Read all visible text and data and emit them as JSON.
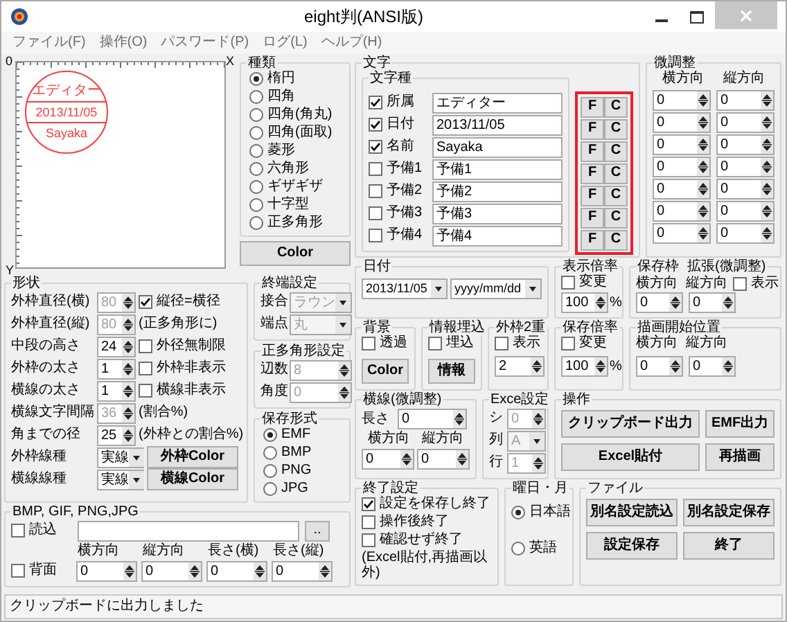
{
  "window": {
    "title": "eight判(ANSI版)"
  },
  "menu": [
    "ファイル(F)",
    "操作(O)",
    "パスワード(P)",
    "ログ(L)",
    "ヘルプ(H)"
  ],
  "preview": {
    "origin": "0",
    "x_axis": "X",
    "y_axis": "Y",
    "stamp": [
      "エディター",
      "2013/11/05",
      "Sayaka"
    ]
  },
  "shape_type": {
    "title": "種類",
    "options": [
      {
        "label": "楕円",
        "selected": true
      },
      {
        "label": "四角",
        "selected": false
      },
      {
        "label": "四角(角丸)",
        "selected": false
      },
      {
        "label": "四角(面取)",
        "selected": false
      },
      {
        "label": "菱形",
        "selected": false
      },
      {
        "label": "六角形",
        "selected": false
      },
      {
        "label": "ギザギザ",
        "selected": false
      },
      {
        "label": "十字型",
        "selected": false
      },
      {
        "label": "正多角形",
        "selected": false
      }
    ]
  },
  "color_button": "Color",
  "shape": {
    "title": "形状",
    "rows": [
      {
        "label": "外枠直径(横)",
        "kind": "spin",
        "value": "80",
        "disabled": true,
        "check": {
          "label": "縦径=横径",
          "checked": true
        }
      },
      {
        "label": "外枠直径(縦)",
        "kind": "spin",
        "value": "80",
        "disabled": true,
        "note": "(正多角形に)"
      },
      {
        "label": "中段の高さ",
        "kind": "spin",
        "value": "24",
        "disabled": false,
        "check": {
          "label": "外径無制限",
          "checked": false
        }
      },
      {
        "label": "外枠の太さ",
        "kind": "spin",
        "value": "1",
        "disabled": false,
        "check": {
          "label": "外枠非表示",
          "checked": false
        }
      },
      {
        "label": "横線の太さ",
        "kind": "spin",
        "value": "1",
        "disabled": false,
        "check": {
          "label": "横線非表示",
          "checked": false
        }
      },
      {
        "label": "横線文字間隔",
        "kind": "spin",
        "value": "36",
        "disabled": true,
        "note": "(割合%)"
      },
      {
        "label": "角までの径",
        "kind": "spin",
        "value": "25",
        "disabled": false,
        "note": "(外枠との割合%)"
      },
      {
        "label": "外枠線種",
        "kind": "select",
        "value": "実線",
        "disabled": false,
        "button": "外枠Color"
      },
      {
        "label": "横線線種",
        "kind": "select",
        "value": "実線",
        "disabled": false,
        "button": "横線Color"
      }
    ]
  },
  "end_settings": {
    "title": "終端設定",
    "disabled": true,
    "rows": [
      {
        "label": "接合",
        "value": "ラウン"
      },
      {
        "label": "端点",
        "value": "丸"
      }
    ]
  },
  "polygon": {
    "title": "正多角形設定",
    "disabled": true,
    "rows": [
      {
        "label": "辺数",
        "value": "8"
      },
      {
        "label": "角度",
        "value": "0"
      }
    ]
  },
  "save_format": {
    "title": "保存形式",
    "options": [
      {
        "label": "EMF",
        "selected": true
      },
      {
        "label": "BMP",
        "selected": false
      },
      {
        "label": "PNG",
        "selected": false
      },
      {
        "label": "JPG",
        "selected": false
      }
    ]
  },
  "image": {
    "title": "BMP, GIF, PNG,JPG",
    "load": {
      "label": "読込",
      "checked": false
    },
    "browse": "..",
    "back": {
      "label": "背面",
      "checked": false
    },
    "columns": [
      "横方向",
      "縦方向",
      "長さ(横)",
      "長さ(縦)"
    ],
    "values": [
      "0",
      "0",
      "0",
      "0"
    ]
  },
  "text": {
    "title": "文字",
    "subtitle": "文字種",
    "rows": [
      {
        "label": "所属",
        "checked": true,
        "value": "エディター",
        "buttons": [
          "F",
          "C"
        ]
      },
      {
        "label": "日付",
        "checked": true,
        "value": "2013/11/05",
        "buttons": [
          "F",
          "C"
        ]
      },
      {
        "label": "名前",
        "checked": true,
        "value": "Sayaka",
        "buttons": [
          "F",
          "C"
        ]
      },
      {
        "label": "予備1",
        "checked": false,
        "value": "予備1",
        "buttons": [
          "F",
          "C"
        ]
      },
      {
        "label": "予備2",
        "checked": false,
        "value": "予備2",
        "buttons": [
          "F",
          "C"
        ]
      },
      {
        "label": "予備3",
        "checked": false,
        "value": "予備3",
        "buttons": [
          "F",
          "C"
        ]
      },
      {
        "label": "予備4",
        "checked": false,
        "value": "予備4",
        "buttons": [
          "F",
          "C"
        ]
      }
    ]
  },
  "fine_adjust": {
    "title": "微調整",
    "columns": [
      "横方向",
      "縦方向"
    ],
    "rows": [
      [
        "0",
        "0"
      ],
      [
        "0",
        "0"
      ],
      [
        "0",
        "0"
      ],
      [
        "0",
        "0"
      ],
      [
        "0",
        "0"
      ],
      [
        "0",
        "0"
      ],
      [
        "0",
        "0"
      ]
    ]
  },
  "date": {
    "title": "日付",
    "value": "2013/11/05",
    "format": "yyyy/mm/dd"
  },
  "display_scale": {
    "title": "表示倍率",
    "check": {
      "label": "変更",
      "checked": false
    },
    "value": "100",
    "unit": "%"
  },
  "save_frame": {
    "title": "保存枠",
    "subtitle": "拡張(微調整)",
    "columns": [
      "横方向",
      "縦方向"
    ],
    "check": {
      "label": "表示",
      "checked": false
    },
    "values": [
      "0",
      "0"
    ]
  },
  "background": {
    "title": "背景",
    "check": {
      "label": "透過",
      "checked": false
    },
    "button": "Color"
  },
  "info": {
    "title": "情報埋込",
    "check": {
      "label": "埋込",
      "checked": false
    },
    "button": "情報"
  },
  "double_frame": {
    "title": "外枠2重",
    "check": {
      "label": "表示",
      "checked": false
    },
    "value": "2"
  },
  "save_scale": {
    "title": "保存倍率",
    "check": {
      "label": "変更",
      "checked": false
    },
    "value": "100",
    "unit": "%"
  },
  "draw_start": {
    "title": "描画開始位置",
    "columns": [
      "横方向",
      "縦方向"
    ],
    "values": [
      "0",
      "0"
    ]
  },
  "line_adjust": {
    "title": "横線(微調整)",
    "length_label": "長さ",
    "length": "0",
    "columns": [
      "横方向",
      "縦方向"
    ],
    "values": [
      "0",
      "0"
    ]
  },
  "excel": {
    "title": "Exce設定",
    "disabled": true,
    "rows": [
      {
        "label": "シ",
        "kind": "spin",
        "value": "0"
      },
      {
        "label": "列",
        "kind": "select",
        "value": "A"
      },
      {
        "label": "行",
        "kind": "spin",
        "value": "1"
      }
    ]
  },
  "operation": {
    "title": "操作",
    "buttons": [
      "クリップボード出力",
      "EMF出力",
      "Excel貼付",
      "再描画"
    ]
  },
  "exit": {
    "title": "終了設定",
    "options": [
      {
        "label": "設定を保存し終了",
        "checked": true
      },
      {
        "label": "操作後終了",
        "checked": false
      },
      {
        "label": "確認せず終了",
        "checked": false
      }
    ],
    "note": "(Excel貼付,再描画以外)"
  },
  "weekday": {
    "title": "曜日・月",
    "options": [
      {
        "label": "日本語",
        "selected": true
      },
      {
        "label": "英語",
        "selected": false
      }
    ]
  },
  "file": {
    "title": "ファイル",
    "buttons": [
      "別名設定読込",
      "別名設定保存",
      "設定保存",
      "終了"
    ]
  },
  "status_bar": "クリップボードに出力しました"
}
